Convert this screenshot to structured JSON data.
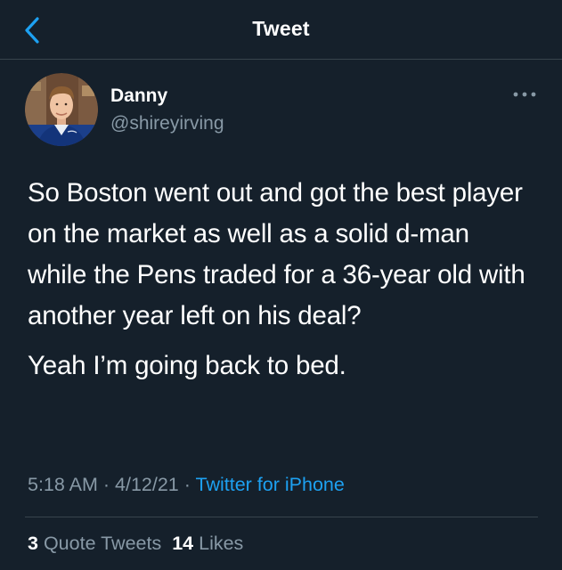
{
  "header": {
    "title": "Tweet",
    "back_icon": "chevron-left-icon"
  },
  "author": {
    "name": "Danny",
    "handle": "@shireyirving",
    "avatar_icon": "avatar-photo"
  },
  "more_icon": "more-horizontal-icon",
  "tweet": {
    "paragraphs": [
      "So Boston went out and got the best player on the market as well as a solid d-man while the Pens traded for a 36-year old with another year left on his deal?",
      "Yeah I’m going back to bed."
    ],
    "time": "5:18 AM",
    "date": "4/12/21",
    "separator": "·",
    "source": "Twitter for iPhone"
  },
  "stats": {
    "quote_tweets_count": "3",
    "quote_tweets_label": "Quote Tweets",
    "likes_count": "14",
    "likes_label": "Likes"
  },
  "colors": {
    "background": "#15202b",
    "text": "#ffffff",
    "secondary_text": "#8899a6",
    "accent": "#1da1f2",
    "divider": "#38444d"
  }
}
